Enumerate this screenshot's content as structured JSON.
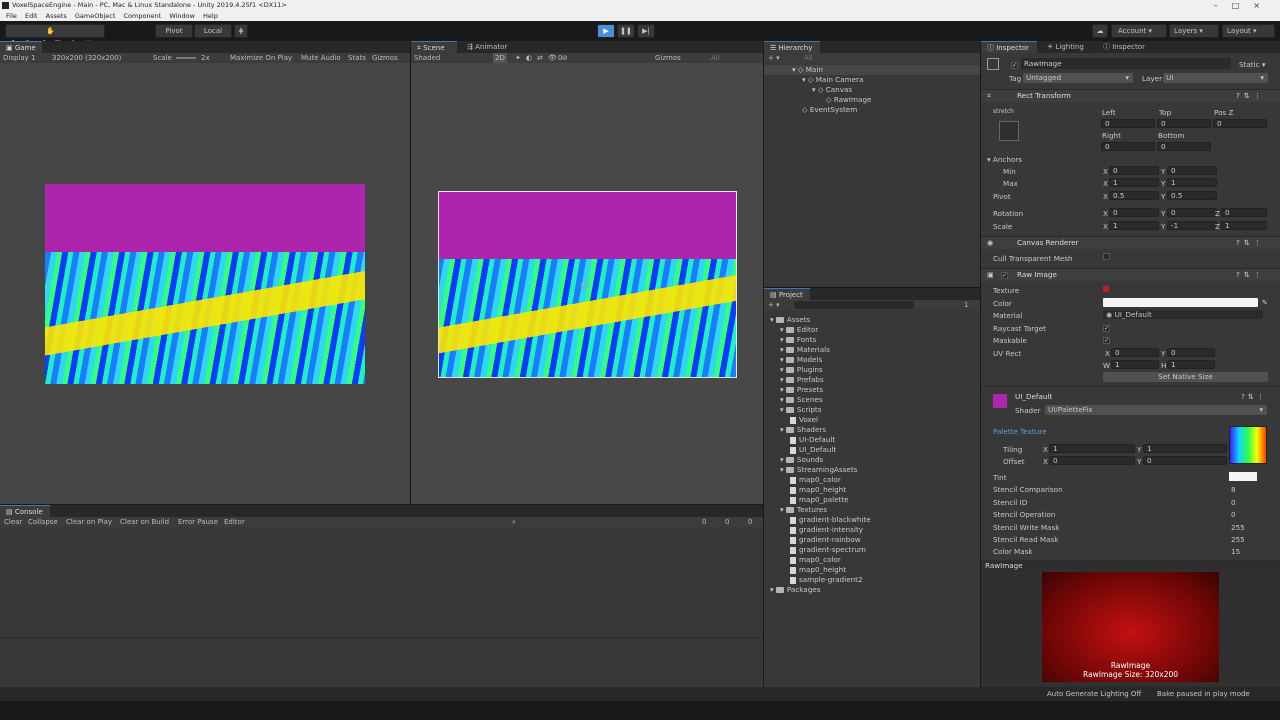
{
  "window": {
    "title": "VoxelSpaceEngine - Main - PC, Mac & Linux Standalone - Unity 2019.4.25f1 <DX11>"
  },
  "menu": [
    "File",
    "Edit",
    "Assets",
    "GameObject",
    "Component",
    "Window",
    "Help"
  ],
  "toolbar": {
    "pivot": "Pivot",
    "local": "Local",
    "account": "Account",
    "layers": "Layers",
    "layout": "Layout"
  },
  "game": {
    "tab": "Game",
    "display": "Display 1",
    "resolution": "320x200 (320x200)",
    "scale_label": "Scale",
    "scale_value": "2x",
    "maximize": "Maximize On Play",
    "mute": "Mute Audio",
    "stats": "Stats",
    "gizmos": "Gizmos"
  },
  "scene": {
    "tab": "Scene",
    "animator_tab": "Animator",
    "shaded": "Shaded",
    "mode2d": "2D",
    "gizmos": "Gizmos",
    "all": "All",
    "counter": "0"
  },
  "console": {
    "tab": "Console",
    "clear": "Clear",
    "collapse": "Collapse",
    "clear_on_play": "Clear on Play",
    "clear_on_build": "Clear on Build",
    "error_pause": "Error Pause",
    "editor": "Editor",
    "count_log": "0",
    "count_warn": "0",
    "count_err": "0"
  },
  "hierarchy": {
    "tab": "Hierarchy",
    "search": "All",
    "items": [
      {
        "label": "Main",
        "depth": 0
      },
      {
        "label": "Main Camera",
        "depth": 1
      },
      {
        "label": "Canvas",
        "depth": 1
      },
      {
        "label": "RawImage",
        "depth": 2
      },
      {
        "label": "EventSystem",
        "depth": 1
      }
    ]
  },
  "project": {
    "tab": "Project",
    "count": "1",
    "tree": [
      {
        "label": "Assets",
        "depth": 0,
        "type": "folder"
      },
      {
        "label": "Editor",
        "depth": 1,
        "type": "folder"
      },
      {
        "label": "Fonts",
        "depth": 1,
        "type": "folder"
      },
      {
        "label": "Materials",
        "depth": 1,
        "type": "folder"
      },
      {
        "label": "Models",
        "depth": 1,
        "type": "folder"
      },
      {
        "label": "Plugins",
        "depth": 1,
        "type": "folder"
      },
      {
        "label": "Prefabs",
        "depth": 1,
        "type": "folder"
      },
      {
        "label": "Presets",
        "depth": 1,
        "type": "folder"
      },
      {
        "label": "Scenes",
        "depth": 1,
        "type": "folder"
      },
      {
        "label": "Scripts",
        "depth": 1,
        "type": "folder"
      },
      {
        "label": "Voxel",
        "depth": 2,
        "type": "file"
      },
      {
        "label": "Shaders",
        "depth": 1,
        "type": "folder"
      },
      {
        "label": "UI-Default",
        "depth": 2,
        "type": "file"
      },
      {
        "label": "UI_Default",
        "depth": 2,
        "type": "file"
      },
      {
        "label": "Sounds",
        "depth": 1,
        "type": "folder"
      },
      {
        "label": "StreamingAssets",
        "depth": 1,
        "type": "folder"
      },
      {
        "label": "map0_color",
        "depth": 2,
        "type": "file"
      },
      {
        "label": "map0_height",
        "depth": 2,
        "type": "file"
      },
      {
        "label": "map0_palette",
        "depth": 2,
        "type": "file"
      },
      {
        "label": "Textures",
        "depth": 1,
        "type": "folder"
      },
      {
        "label": "gradient-blackwhite",
        "depth": 2,
        "type": "file"
      },
      {
        "label": "gradient-intensity",
        "depth": 2,
        "type": "file"
      },
      {
        "label": "gradient-rainbow",
        "depth": 2,
        "type": "file"
      },
      {
        "label": "gradient-spectrum",
        "depth": 2,
        "type": "file"
      },
      {
        "label": "map0_color",
        "depth": 2,
        "type": "file"
      },
      {
        "label": "map0_height",
        "depth": 2,
        "type": "file"
      },
      {
        "label": "sample-gradient2",
        "depth": 2,
        "type": "file"
      },
      {
        "label": "Packages",
        "depth": 0,
        "type": "folder"
      }
    ]
  },
  "inspector": {
    "tabs": [
      "Inspector",
      "Lighting",
      "Inspector"
    ],
    "object_name": "RawImage",
    "static": "Static",
    "tag_label": "Tag",
    "tag": "Untagged",
    "layer_label": "Layer",
    "layer": "UI",
    "rect": {
      "title": "Rect Transform",
      "stretch": "stretch",
      "left_l": "Left",
      "top_l": "Top",
      "posz_l": "Pos Z",
      "left": "0",
      "top": "0",
      "posz": "0",
      "right_l": "Right",
      "bottom_l": "Bottom",
      "right": "0",
      "bottom": "0",
      "anchors": "Anchors",
      "min": "Min",
      "max": "Max",
      "pivot": "Pivot",
      "rotation": "Rotation",
      "scale": "Scale",
      "min_x": "0",
      "min_y": "0",
      "max_x": "1",
      "max_y": "1",
      "pivot_x": "0.5",
      "pivot_y": "0.5",
      "rot_x": "0",
      "rot_y": "0",
      "rot_z": "0",
      "scale_x": "1",
      "scale_y": "-1",
      "scale_z": "1"
    },
    "canvas_renderer": {
      "title": "Canvas Renderer",
      "cull": "Cull Transparent Mesh"
    },
    "raw_image": {
      "title": "Raw Image",
      "texture": "Texture",
      "color": "Color",
      "material": "Material",
      "material_value": "UI_Default",
      "raycast": "Raycast Target",
      "maskable": "Maskable",
      "uvrect": "UV Rect",
      "uv_x": "0",
      "uv_y": "0",
      "uv_w": "1",
      "uv_h": "1",
      "native": "Set Native Size"
    },
    "material": {
      "name": "UI_Default",
      "shader_label": "Shader",
      "shader": "UI/PaletteFix",
      "palette": "Palette Texture",
      "tiling": "Tiling",
      "offset": "Offset",
      "tx": "1",
      "ty": "1",
      "ox": "0",
      "oy": "0",
      "tint": "Tint",
      "stencil_comp": "Stencil Comparison",
      "stencil_comp_v": "8",
      "stencil_id": "Stencil ID",
      "stencil_id_v": "0",
      "stencil_op": "Stencil Operation",
      "stencil_op_v": "0",
      "stencil_write": "Stencil Write Mask",
      "stencil_write_v": "255",
      "stencil_read": "Stencil Read Mask",
      "stencil_read_v": "255",
      "color_mask": "Color Mask",
      "color_mask_v": "15"
    },
    "preview": {
      "title": "RawImage",
      "caption": "RawImage",
      "size": "RawImage Size: 320x200"
    }
  },
  "status": {
    "lighting": "Auto Generate Lighting Off",
    "bake": "Bake paused in play mode"
  },
  "colors": {
    "accent": "#3a79bb",
    "sky": "#ad25ad",
    "play_active": "#4a90d9"
  }
}
